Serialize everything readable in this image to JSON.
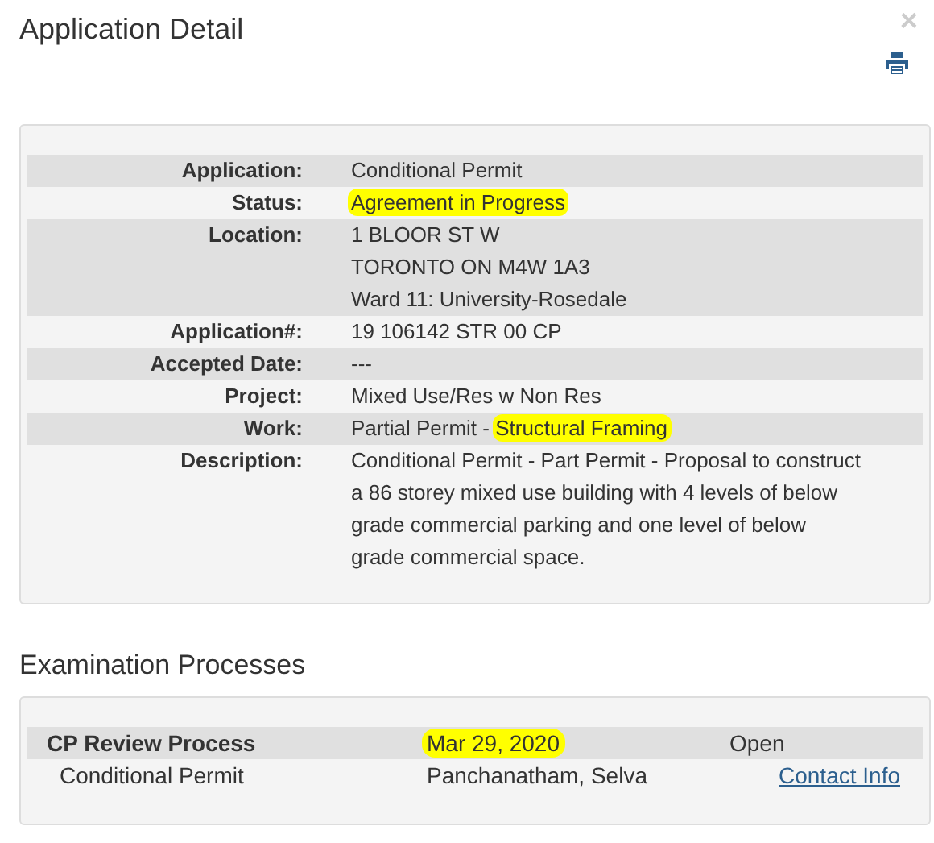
{
  "dialog": {
    "title": "Application Detail",
    "close": "×"
  },
  "details": [
    {
      "label": "Application:",
      "lines": [
        [
          {
            "text": "Conditional Permit",
            "highlighted": false
          }
        ]
      ]
    },
    {
      "label": "Status:",
      "lines": [
        [
          {
            "text": "Agreement in Progress",
            "highlighted": true
          }
        ]
      ]
    },
    {
      "label": "Location:",
      "lines": [
        [
          {
            "text": "1 BLOOR ST W",
            "highlighted": false
          }
        ],
        [
          {
            "text": "TORONTO ON M4W 1A3",
            "highlighted": false
          }
        ],
        [
          {
            "text": "Ward 11: University-Rosedale",
            "highlighted": false
          }
        ]
      ]
    },
    {
      "label": "Application#:",
      "lines": [
        [
          {
            "text": "19 106142 STR 00 CP",
            "highlighted": false
          }
        ]
      ]
    },
    {
      "label": "Accepted Date:",
      "lines": [
        [
          {
            "text": "---",
            "highlighted": false
          }
        ]
      ]
    },
    {
      "label": "Project:",
      "lines": [
        [
          {
            "text": "Mixed Use/Res w Non Res",
            "highlighted": false
          }
        ]
      ]
    },
    {
      "label": "Work:",
      "lines": [
        [
          {
            "text": "Partial Permit - ",
            "highlighted": false
          },
          {
            "text": "Structural Framing",
            "highlighted": true
          }
        ]
      ]
    },
    {
      "label": "Description:",
      "lines": [
        [
          {
            "text": "Conditional Permit - Part Permit - Proposal to construct a 86 storey mixed use building with 4 levels of below grade commercial parking and one level of below grade commercial space.",
            "highlighted": false
          }
        ]
      ]
    }
  ],
  "examination": {
    "heading": "Examination Processes",
    "processes": [
      {
        "name": "CP Review Process",
        "date": {
          "text": "Mar 29, 2020",
          "highlighted": true
        },
        "status": "Open",
        "type": "Conditional Permit",
        "reviewer": "Panchanatham, Selva",
        "link": "Contact Info"
      }
    ]
  }
}
